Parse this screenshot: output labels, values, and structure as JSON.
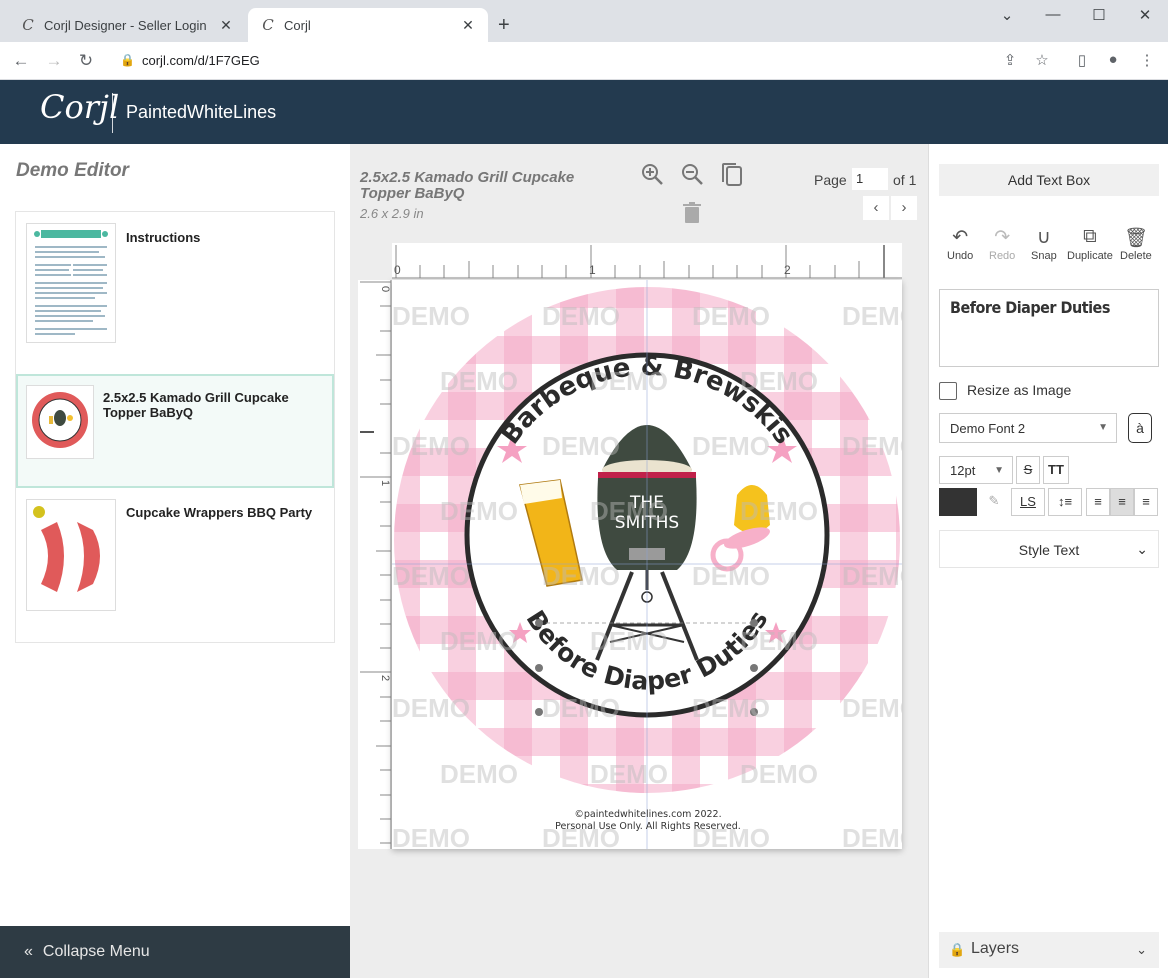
{
  "browser": {
    "tabs": [
      {
        "title": "Corjl Designer - Seller Login",
        "active": false
      },
      {
        "title": "Corjl",
        "active": true
      }
    ],
    "url": "corjl.com/d/1F7GEG"
  },
  "header": {
    "logo": "Corjl",
    "shop_name": "PaintedWhiteLines"
  },
  "left_panel": {
    "title": "Demo Editor",
    "templates": [
      {
        "name": "Instructions",
        "selected": false
      },
      {
        "name": "2.5x2.5 Kamado Grill Cupcake Topper BaByQ",
        "selected": true
      },
      {
        "name": "Cupcake Wrappers BBQ Party",
        "selected": false
      }
    ],
    "collapse_label": "Collapse Menu"
  },
  "center": {
    "product_title": "2.5x2.5 Kamado Grill Cupcake Topper BaByQ",
    "product_size": "2.6 x 2.9 in",
    "page_label": "Page",
    "page_current": "1",
    "page_total_label": "of 1",
    "ruler_top": [
      "0",
      "1",
      "2"
    ],
    "ruler_left": [
      "0",
      "1",
      "2"
    ],
    "design": {
      "top_text": "Barbeque & Brewskis",
      "name_line1": "THE",
      "name_line2": "SMITHS",
      "bottom_text": "Before Diaper Duties",
      "watermark": "DEMO",
      "copyright_line1": "©paintedwhitelines.com 2022.",
      "copyright_line2": "Personal Use Only. All Rights Reserved.",
      "gingham_color": "#f4a9c7",
      "grill_color": "#3f4a40"
    }
  },
  "right_panel": {
    "add_text_box": "Add Text Box",
    "tools": [
      {
        "label": "Undo",
        "enabled": true
      },
      {
        "label": "Redo",
        "enabled": false
      },
      {
        "label": "Snap",
        "enabled": true
      },
      {
        "label": "Duplicate",
        "enabled": true
      },
      {
        "label": "Delete",
        "enabled": true
      }
    ],
    "text_value": "Before Diaper Duties",
    "resize_as_image": "Resize as Image",
    "font": "Demo Font 2",
    "font_size": "12pt",
    "text_color": "#333333",
    "style_text": "Style Text",
    "layers": "Layers"
  }
}
